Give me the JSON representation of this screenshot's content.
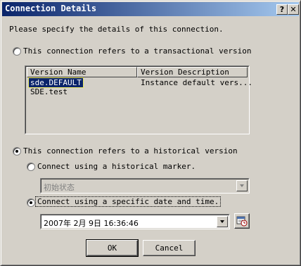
{
  "window": {
    "title": "Connection Details",
    "help_label": "?",
    "close_label": "✕"
  },
  "prompt": "Please specify the details of this connection.",
  "transactional": {
    "label": "This connection refers to a transactional version",
    "selected": false
  },
  "versions": {
    "columns": [
      "Version Name",
      "Version Description"
    ],
    "rows": [
      {
        "name": "sde.DEFAULT",
        "description": "Instance default vers...",
        "selected": true
      },
      {
        "name": "SDE.test",
        "description": "",
        "selected": false
      }
    ]
  },
  "historical": {
    "label": "This connection refers to a historical version",
    "selected": true,
    "marker": {
      "label": "Connect using a historical marker.",
      "selected": false,
      "value": "初始状态",
      "enabled": false
    },
    "datetime": {
      "label": "Connect using a specific date and time.",
      "selected": true,
      "value": "2007年 2月 9日 16:36:46"
    }
  },
  "buttons": {
    "ok": "OK",
    "cancel": "Cancel"
  },
  "icons": {
    "calendar_icon": "calendar-clock-icon"
  }
}
